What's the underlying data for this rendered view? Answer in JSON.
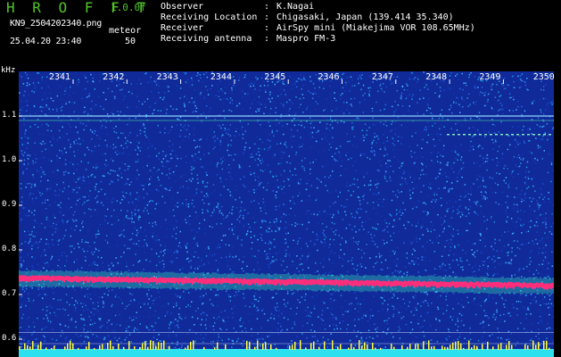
{
  "header": {
    "logo": "H R O F F T",
    "version": "1.0.0f",
    "filename": "KN9_2504202340.png",
    "mode_label": "meteor",
    "datetime": "25.04.20 23:40",
    "count": "50"
  },
  "info": {
    "observer_label": "Observer",
    "observer_value": "K.Nagai",
    "location_label": "Receiving Location",
    "location_value": "Chigasaki, Japan (139.414 35.340)",
    "receiver_label": "Receiver",
    "receiver_value": "AirSpy mini (Miakejima VOR 108.65MHz)",
    "antenna_label": "Receiving antenna",
    "antenna_value": "Maspro FM-3",
    "separator": ":"
  },
  "spectrogram": {
    "y_unit": "kHz",
    "y_ticks": [
      {
        "value": 1.1,
        "label": "1.1"
      },
      {
        "value": 1.0,
        "label": "1.0"
      },
      {
        "value": 0.9,
        "label": "0.9"
      },
      {
        "value": 0.8,
        "label": "0.8"
      },
      {
        "value": 0.7,
        "label": "0.7"
      },
      {
        "value": 0.6,
        "label": "0.6"
      }
    ],
    "x_ticks": [
      "2341",
      "2342",
      "2343",
      "2344",
      "2345",
      "2346",
      "2347",
      "2348",
      "2349",
      "2350"
    ],
    "colors": {
      "background": "#102a9a",
      "noise": "#2f7fe0",
      "carrier": "#ff2d7a",
      "carrier_edge": "#38e6b8",
      "baseline": "#ffff40",
      "floor": "#2ce0f0"
    }
  }
}
